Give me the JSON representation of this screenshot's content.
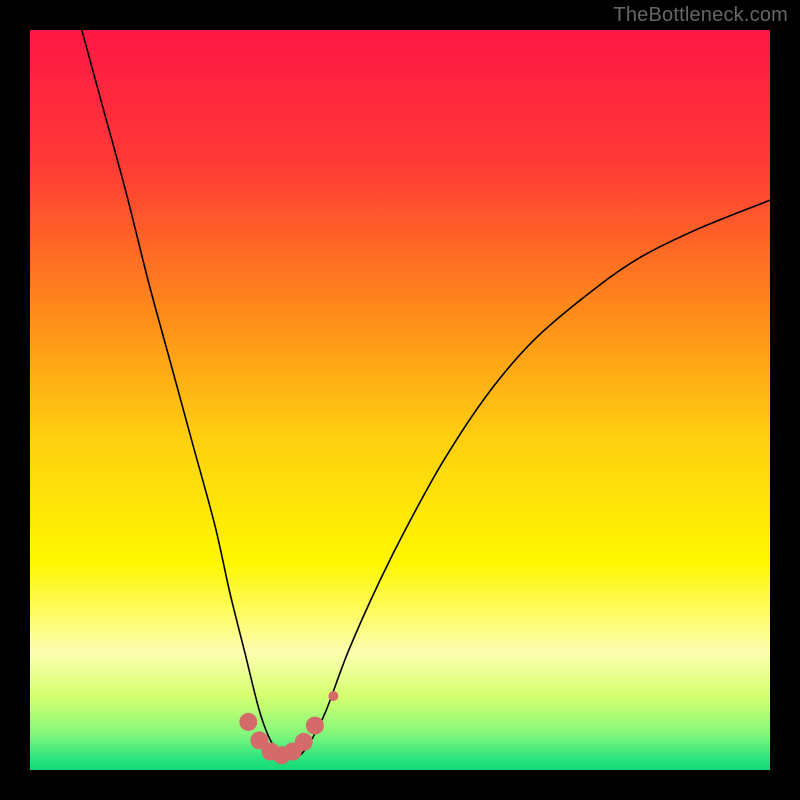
{
  "watermark": {
    "text": "TheBottleneck.com"
  },
  "chart_data": {
    "type": "line",
    "title": "",
    "xlabel": "",
    "ylabel": "",
    "xlim": [
      0,
      100
    ],
    "ylim": [
      0,
      100
    ],
    "grid": false,
    "legend": false,
    "background_gradient": {
      "stops": [
        {
          "offset": 0.0,
          "color": "#ff1745"
        },
        {
          "offset": 0.18,
          "color": "#ff3a36"
        },
        {
          "offset": 0.38,
          "color": "#ff8a1a"
        },
        {
          "offset": 0.55,
          "color": "#ffcf10"
        },
        {
          "offset": 0.72,
          "color": "#fff700"
        },
        {
          "offset": 0.84,
          "color": "#fdffb0"
        },
        {
          "offset": 0.9,
          "color": "#d6ff70"
        },
        {
          "offset": 0.95,
          "color": "#86f87a"
        },
        {
          "offset": 0.985,
          "color": "#29e47f"
        },
        {
          "offset": 1.0,
          "color": "#14d877"
        }
      ]
    },
    "series": [
      {
        "name": "bottleneck-curve",
        "style": {
          "stroke": "#000000",
          "stroke_width": 1.6,
          "fill": "none"
        },
        "x": [
          7,
          10,
          13,
          16,
          19,
          22,
          25,
          27,
          29,
          31,
          32.5,
          34,
          35,
          36.5,
          38,
          40,
          43,
          47,
          51,
          56,
          62,
          68,
          75,
          82,
          90,
          100
        ],
        "y": [
          100,
          89,
          78,
          66,
          55,
          44,
          33,
          24,
          16,
          8,
          4,
          2,
          1.5,
          2,
          4,
          8,
          16,
          25,
          33,
          42,
          51,
          58,
          64,
          69,
          73,
          77
        ]
      }
    ],
    "markers": {
      "name": "optimal-range-markers",
      "style": {
        "fill": "#d46a6a",
        "radius_small": 5,
        "radius_large": 9
      },
      "points": [
        {
          "x": 29.5,
          "y": 6.5,
          "r": "large"
        },
        {
          "x": 31.0,
          "y": 4.0,
          "r": "large"
        },
        {
          "x": 32.5,
          "y": 2.5,
          "r": "large"
        },
        {
          "x": 34.0,
          "y": 2.0,
          "r": "large"
        },
        {
          "x": 35.5,
          "y": 2.5,
          "r": "large"
        },
        {
          "x": 37.0,
          "y": 3.8,
          "r": "large"
        },
        {
          "x": 38.5,
          "y": 6.0,
          "r": "large"
        },
        {
          "x": 41.0,
          "y": 10.0,
          "r": "small"
        }
      ]
    }
  }
}
